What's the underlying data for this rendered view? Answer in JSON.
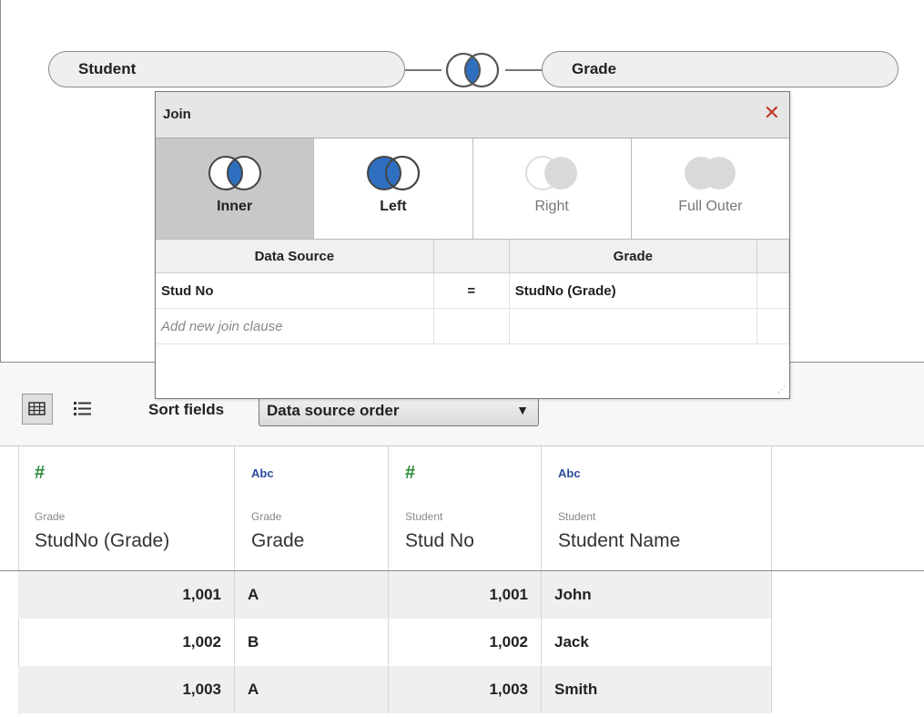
{
  "canvas": {
    "left_table": "Student",
    "right_table": "Grade"
  },
  "join_dialog": {
    "title": "Join",
    "close_icon": "close-icon",
    "join_types": [
      {
        "label": "Inner",
        "state": "selected",
        "icon": "inner-join-icon"
      },
      {
        "label": "Left",
        "state": "active",
        "icon": "left-join-icon"
      },
      {
        "label": "Right",
        "state": "disabled",
        "icon": "right-join-icon"
      },
      {
        "label": "Full Outer",
        "state": "disabled",
        "icon": "full-outer-join-icon"
      }
    ],
    "clause_headers": {
      "left": "Data Source",
      "op": "",
      "right": "Grade"
    },
    "clauses": [
      {
        "left": "Stud No",
        "op": "=",
        "right": "StudNo (Grade)"
      }
    ],
    "add_clause_label": "Add new join clause"
  },
  "toolbar": {
    "grid_view_icon": "grid-view-icon",
    "list_view_icon": "list-view-icon",
    "sort_label": "Sort fields",
    "sort_value": "Data source order"
  },
  "grid": {
    "columns": [
      {
        "type_icon": "#",
        "type": "number",
        "source": "Grade",
        "name": "StudNo (Grade)"
      },
      {
        "type_icon": "Abc",
        "type": "string",
        "source": "Grade",
        "name": "Grade"
      },
      {
        "type_icon": "#",
        "type": "number",
        "source": "Student",
        "name": "Stud No"
      },
      {
        "type_icon": "Abc",
        "type": "string",
        "source": "Student",
        "name": "Student Name"
      }
    ],
    "rows": [
      [
        "1,001",
        "A",
        "1,001",
        "John"
      ],
      [
        "1,002",
        "B",
        "1,002",
        "Jack"
      ],
      [
        "1,003",
        "A",
        "1,003",
        "Smith"
      ]
    ]
  },
  "colors": {
    "join_fill": "#2f6fc0",
    "disabled_fill": "#d9d9d9",
    "close": "#c0392b",
    "number_icon": "#2a8a3a",
    "string_icon": "#2b4b9a"
  }
}
